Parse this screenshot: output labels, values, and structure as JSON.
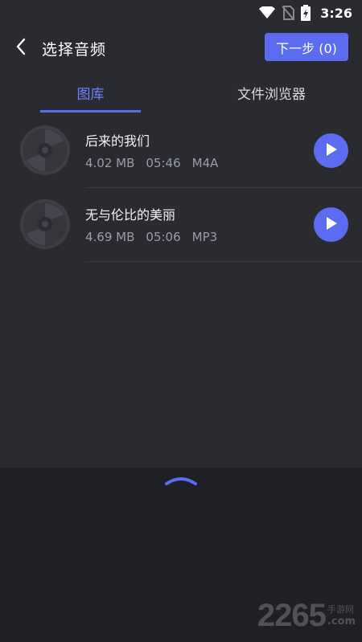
{
  "status_bar": {
    "time": "3:26",
    "icons": [
      "wifi-icon",
      "no-sim-icon",
      "battery-charging-icon"
    ]
  },
  "header": {
    "title": "选择音频",
    "next_label": "下一步 (0)"
  },
  "tabs": [
    {
      "label": "图库",
      "active": true
    },
    {
      "label": "文件浏览器",
      "active": false
    }
  ],
  "songs": [
    {
      "title": "后来的我们",
      "size": "4.02 MB",
      "duration": "05:46",
      "format": "M4A"
    },
    {
      "title": "无与伦比的美丽",
      "size": "4.69 MB",
      "duration": "05:06",
      "format": "MP3"
    }
  ],
  "watermark": {
    "number": "2265",
    "text": "手游网",
    "domain": ".com"
  },
  "colors": {
    "accent": "#5b6cf0",
    "tab_active": "#6f82ff",
    "panel": "#2a2b31",
    "background": "#1f2026"
  }
}
